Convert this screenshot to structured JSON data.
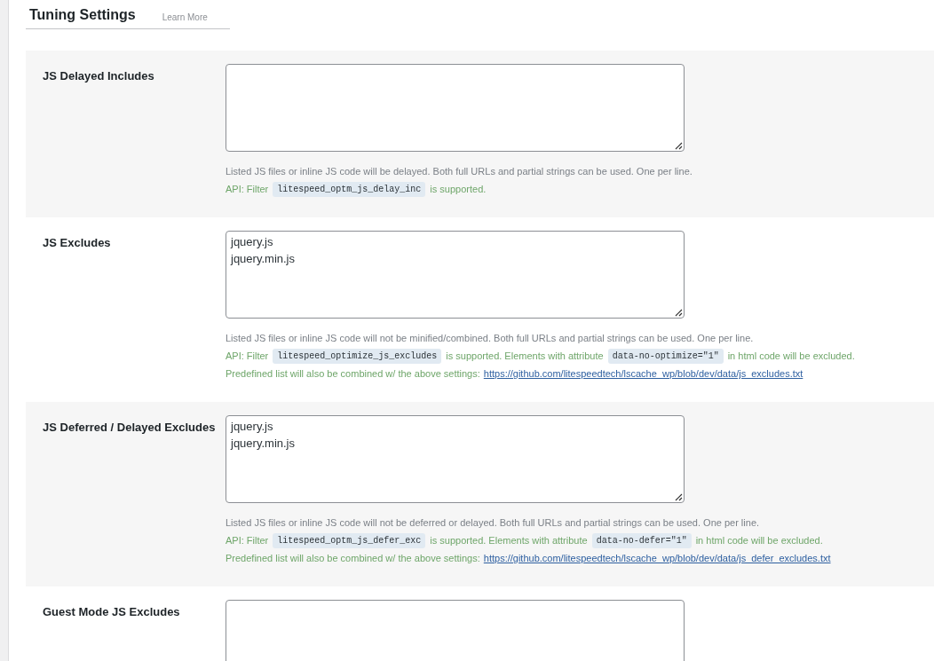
{
  "header": {
    "title": "Tuning Settings",
    "link": "Learn More"
  },
  "settings": [
    {
      "label": "JS Delayed Includes",
      "description": "Listed JS files or inline JS code will be delayed. Both full URLs and partial strings can be used. One per line.",
      "api": [
        {
          "kind": "text",
          "text": "API: Filter"
        },
        {
          "kind": "code",
          "text": "litespeed_optm_js_delay_inc"
        },
        {
          "kind": "text",
          "text": "is supported."
        }
      ]
    },
    {
      "label": "JS Excludes",
      "value": "jquery.js\njquery.min.js",
      "description": "Listed JS files or inline JS code will not be minified/combined. Both full URLs and partial strings can be used. One per line.",
      "api": [
        {
          "kind": "text",
          "text": "API: Filter"
        },
        {
          "kind": "code",
          "text": "litespeed_optimize_js_excludes"
        },
        {
          "kind": "text",
          "text": "is supported. Elements with attribute"
        },
        {
          "kind": "code",
          "text": "data-no-optimize=\"1\""
        },
        {
          "kind": "text",
          "text": "in html code will be excluded."
        }
      ],
      "predefined": {
        "text": "Predefined list will also be combined w/ the above settings:",
        "link": "https://github.com/litespeedtech/lscache_wp/blob/dev/data/js_excludes.txt"
      }
    },
    {
      "label": "JS Deferred / Delayed Excludes",
      "value": "jquery.js\njquery.min.js",
      "description": "Listed JS files or inline JS code will not be deferred or delayed. Both full URLs and partial strings can be used. One per line.",
      "api": [
        {
          "kind": "text",
          "text": "API: Filter"
        },
        {
          "kind": "code",
          "text": "litespeed_optm_js_defer_exc"
        },
        {
          "kind": "text",
          "text": "is supported. Elements with attribute"
        },
        {
          "kind": "code",
          "text": "data-no-defer=\"1\""
        },
        {
          "kind": "text",
          "text": "in html code will be excluded."
        }
      ],
      "predefined": {
        "text": "Predefined list will also be combined w/ the above settings:",
        "link": "https://github.com/litespeedtech/lscache_wp/blob/dev/data/js_defer_excludes.txt"
      }
    },
    {
      "label": "Guest Mode JS Excludes"
    }
  ]
}
